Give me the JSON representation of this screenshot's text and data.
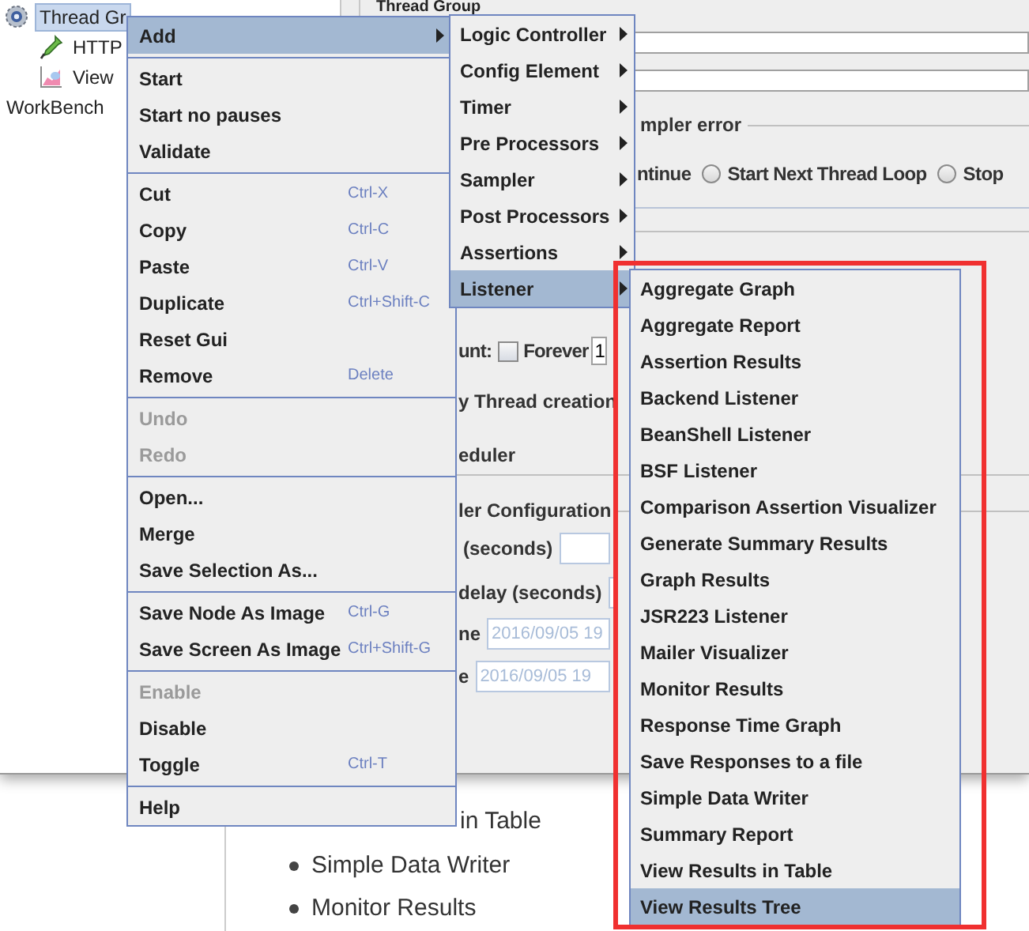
{
  "tree": [
    {
      "label": "Thread Gr",
      "kind": "thread-group",
      "selected": true,
      "children": [
        {
          "label": "HTTP",
          "kind": "sampler",
          "selected": false
        },
        {
          "label": "View",
          "kind": "listener",
          "selected": false
        }
      ]
    },
    {
      "label": "WorkBench",
      "kind": "workbench",
      "selected": false
    }
  ],
  "panel": {
    "title": "Thread Group",
    "error_group_label": "mpler error",
    "error_action": {
      "label": "ntinue",
      "options": [
        {
          "label": "Start Next Thread Loop",
          "selected": false
        },
        {
          "label": "Stop",
          "selected": false
        }
      ]
    },
    "loop": {
      "label": "unt:",
      "forever": {
        "label": "Forever",
        "checked": false
      },
      "value": "1"
    },
    "thread_creation_label": "y Thread creation",
    "scheduler_label": "eduler",
    "scheduler_group_label": "ler Configuration",
    "duration_label": "(seconds)",
    "startup_delay_label": "delay (seconds)",
    "start_time": {
      "label": "ne",
      "value": "2016/09/05 19"
    },
    "end_time": {
      "label": "e",
      "value": "2016/09/05 19"
    }
  },
  "context_menu": {
    "items": [
      {
        "kind": "item",
        "label": "Add",
        "selected": true,
        "disabled": false,
        "submenu": true
      },
      {
        "kind": "separator"
      },
      {
        "kind": "item",
        "label": "Start",
        "selected": false,
        "disabled": false
      },
      {
        "kind": "item",
        "label": "Start no pauses",
        "selected": false,
        "disabled": false
      },
      {
        "kind": "item",
        "label": "Validate",
        "selected": false,
        "disabled": false
      },
      {
        "kind": "separator"
      },
      {
        "kind": "item",
        "label": "Cut",
        "shortcut": "Ctrl-X",
        "selected": false,
        "disabled": false
      },
      {
        "kind": "item",
        "label": "Copy",
        "shortcut": "Ctrl-C",
        "selected": false,
        "disabled": false
      },
      {
        "kind": "item",
        "label": "Paste",
        "shortcut": "Ctrl-V",
        "selected": false,
        "disabled": false
      },
      {
        "kind": "item",
        "label": "Duplicate",
        "shortcut": "Ctrl+Shift-C",
        "selected": false,
        "disabled": false
      },
      {
        "kind": "item",
        "label": "Reset Gui",
        "selected": false,
        "disabled": false
      },
      {
        "kind": "item",
        "label": "Remove",
        "shortcut": "Delete",
        "selected": false,
        "disabled": false
      },
      {
        "kind": "separator"
      },
      {
        "kind": "item",
        "label": "Undo",
        "selected": false,
        "disabled": true
      },
      {
        "kind": "item",
        "label": "Redo",
        "selected": false,
        "disabled": true
      },
      {
        "kind": "separator"
      },
      {
        "kind": "item",
        "label": "Open...",
        "selected": false,
        "disabled": false
      },
      {
        "kind": "item",
        "label": "Merge",
        "selected": false,
        "disabled": false
      },
      {
        "kind": "item",
        "label": "Save Selection As...",
        "selected": false,
        "disabled": false
      },
      {
        "kind": "separator"
      },
      {
        "kind": "item",
        "label": "Save Node As Image",
        "shortcut": "Ctrl-G",
        "selected": false,
        "disabled": false
      },
      {
        "kind": "item",
        "label": "Save Screen As Image",
        "shortcut": "Ctrl+Shift-G",
        "selected": false,
        "disabled": false
      },
      {
        "kind": "separator"
      },
      {
        "kind": "item",
        "label": "Enable",
        "selected": false,
        "disabled": true
      },
      {
        "kind": "item",
        "label": "Disable",
        "selected": false,
        "disabled": false
      },
      {
        "kind": "item",
        "label": "Toggle",
        "shortcut": "Ctrl-T",
        "selected": false,
        "disabled": false
      },
      {
        "kind": "separator"
      },
      {
        "kind": "item",
        "label": "Help",
        "selected": false,
        "disabled": false
      }
    ]
  },
  "add_submenu": {
    "items": [
      {
        "label": "Logic Controller",
        "selected": false
      },
      {
        "label": "Config Element",
        "selected": false
      },
      {
        "label": "Timer",
        "selected": false
      },
      {
        "label": "Pre Processors",
        "selected": false
      },
      {
        "label": "Sampler",
        "selected": false
      },
      {
        "label": "Post Processors",
        "selected": false
      },
      {
        "label": "Assertions",
        "selected": false
      },
      {
        "label": "Listener",
        "selected": true
      }
    ]
  },
  "listener_submenu": {
    "items": [
      {
        "label": "Aggregate Graph",
        "selected": false
      },
      {
        "label": "Aggregate Report",
        "selected": false
      },
      {
        "label": "Assertion Results",
        "selected": false
      },
      {
        "label": "Backend Listener",
        "selected": false
      },
      {
        "label": "BeanShell Listener",
        "selected": false
      },
      {
        "label": "BSF Listener",
        "selected": false
      },
      {
        "label": "Comparison Assertion Visualizer",
        "selected": false
      },
      {
        "label": "Generate Summary Results",
        "selected": false
      },
      {
        "label": "Graph Results",
        "selected": false
      },
      {
        "label": "JSR223 Listener",
        "selected": false
      },
      {
        "label": "Mailer Visualizer",
        "selected": false
      },
      {
        "label": "Monitor Results",
        "selected": false
      },
      {
        "label": "Response Time Graph",
        "selected": false
      },
      {
        "label": "Save Responses to a file",
        "selected": false
      },
      {
        "label": "Simple Data Writer",
        "selected": false
      },
      {
        "label": "Summary Report",
        "selected": false
      },
      {
        "label": "View Results in Table",
        "selected": false
      },
      {
        "label": "View Results Tree",
        "selected": true
      }
    ]
  },
  "page_list": [
    {
      "text": "in Table",
      "bullet_visible": false
    },
    {
      "text": "Simple Data Writer",
      "bullet_visible": true
    },
    {
      "text": "Monitor Results",
      "bullet_visible": true
    }
  ]
}
